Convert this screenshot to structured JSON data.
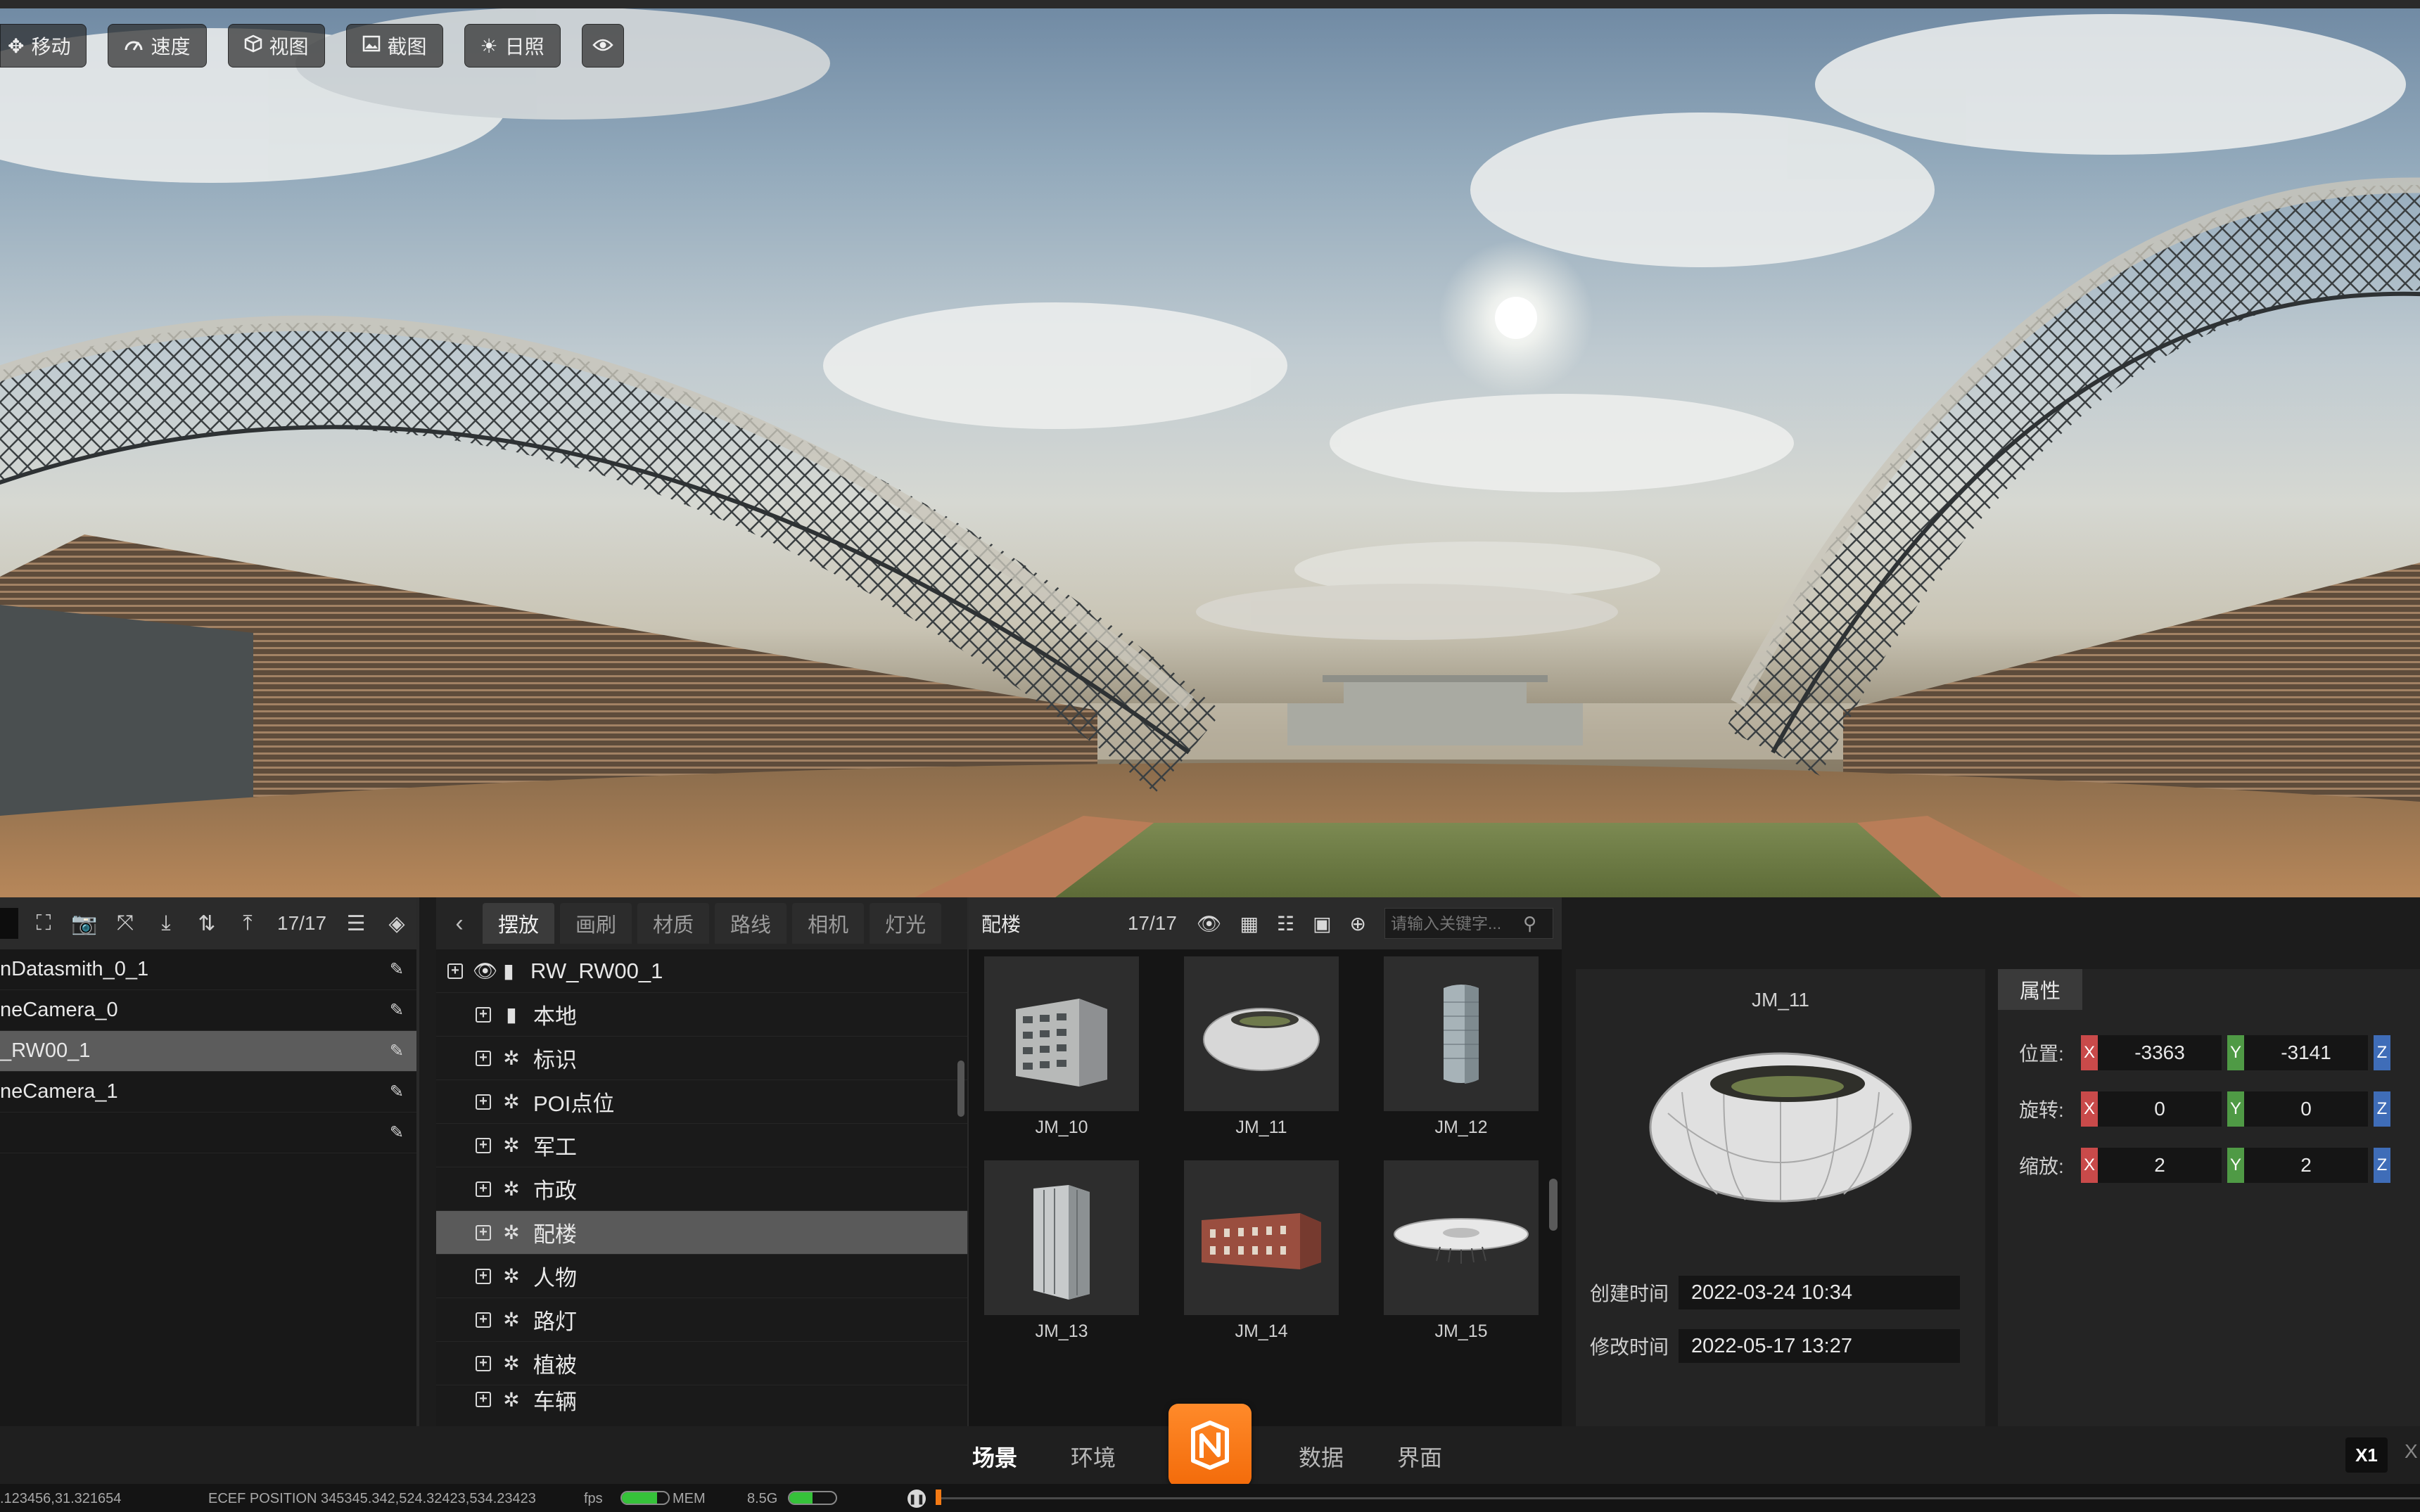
{
  "viewport_toolbar": [
    {
      "label": "移动",
      "icon": "move-icon"
    },
    {
      "label": "速度",
      "icon": "speedometer-icon"
    },
    {
      "label": "视图",
      "icon": "cube-icon"
    },
    {
      "label": "截图",
      "icon": "image-icon"
    },
    {
      "label": "日照",
      "icon": "sun-icon"
    },
    {
      "label": "",
      "icon": "eye-icon"
    }
  ],
  "outline": {
    "count": "17/17",
    "items": [
      {
        "label": "nDatasmith_0_1",
        "selected": false
      },
      {
        "label": "neCamera_0",
        "selected": false
      },
      {
        "label": "_RW00_1",
        "selected": true
      },
      {
        "label": "neCamera_1",
        "selected": false
      },
      {
        "label": "",
        "selected": false
      }
    ]
  },
  "tabs": [
    "摆放",
    "画刷",
    "材质",
    "路线",
    "相机",
    "灯光"
  ],
  "active_tab": "摆放",
  "tree": {
    "root": "RW_RW00_1",
    "items": [
      {
        "label": "本地",
        "icon": "building-icon",
        "selected": false
      },
      {
        "label": "标识",
        "icon": "aperture-icon",
        "selected": false
      },
      {
        "label": "POI点位",
        "icon": "aperture-icon",
        "selected": false
      },
      {
        "label": "军工",
        "icon": "aperture-icon",
        "selected": false
      },
      {
        "label": "市政",
        "icon": "aperture-icon",
        "selected": false
      },
      {
        "label": "配楼",
        "icon": "aperture-icon",
        "selected": true
      },
      {
        "label": "人物",
        "icon": "aperture-icon",
        "selected": false
      },
      {
        "label": "路灯",
        "icon": "aperture-icon",
        "selected": false
      },
      {
        "label": "植被",
        "icon": "aperture-icon",
        "selected": false
      },
      {
        "label": "车辆",
        "icon": "aperture-icon",
        "selected": false
      }
    ]
  },
  "assets": {
    "title": "配楼",
    "count": "17/17",
    "search_placeholder": "请输入关键字...",
    "items": [
      {
        "label": "JM_10",
        "kind": "apartment"
      },
      {
        "label": "JM_11",
        "kind": "stadium"
      },
      {
        "label": "JM_12",
        "kind": "tower"
      },
      {
        "label": "JM_13",
        "kind": "highrise"
      },
      {
        "label": "JM_14",
        "kind": "brick"
      },
      {
        "label": "JM_15",
        "kind": "disc"
      }
    ]
  },
  "preview": {
    "name": "JM_11",
    "created_label": "创建时间",
    "created": "2022-03-24  10:34",
    "modified_label": "修改时间",
    "modified": "2022-05-17  13:27"
  },
  "properties": {
    "tab": "属性",
    "rows": [
      {
        "label": "位置:",
        "x": "-3363",
        "y": "-3141"
      },
      {
        "label": "旋转:",
        "x": "0",
        "y": "0"
      },
      {
        "label": "缩放:",
        "x": "2",
        "y": "2"
      }
    ],
    "axis_x": "X",
    "axis_y": "Y",
    "axis_z": "Z"
  },
  "nav": {
    "items": [
      "场景",
      "环境",
      "数据",
      "界面"
    ],
    "active": "场景",
    "speed": "X1",
    "close": "X"
  },
  "status": {
    "coords": ".123456,31.321654",
    "ecef": "ECEF POSITION 345345.342,524.32423,534.23423",
    "fps_label": "fps",
    "mem_label": "MEM",
    "mem_value": "8.5G",
    "fps_fill": 0.75,
    "mem_fill": 0.5
  },
  "colors": {
    "accent": "#f47a14",
    "axis_x": "#c94a4a",
    "axis_y": "#4f9a45",
    "axis_z": "#3f6db8"
  }
}
